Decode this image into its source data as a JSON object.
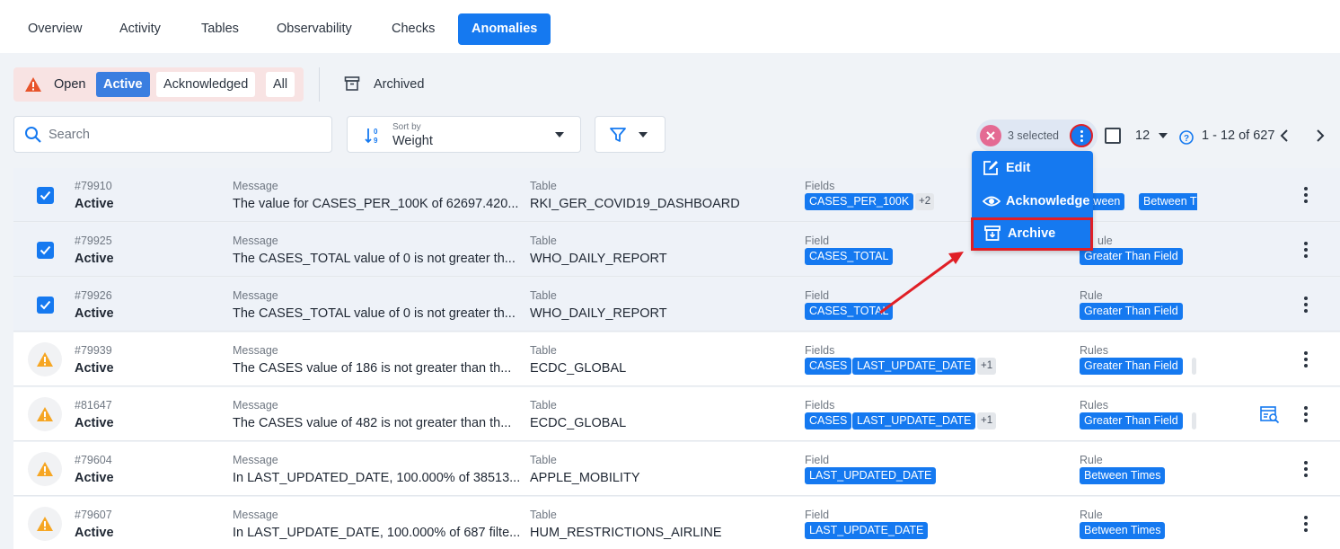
{
  "tabs": [
    "Overview",
    "Activity",
    "Tables",
    "Observability",
    "Checks",
    "Anomalies"
  ],
  "active_tab": "Anomalies",
  "status_filter": {
    "open_label": "Open",
    "options": [
      "Active",
      "Acknowledged",
      "All"
    ],
    "active": "Active",
    "archived_label": "Archived"
  },
  "search": {
    "placeholder": "Search"
  },
  "sort": {
    "label": "Sort by",
    "value": "Weight"
  },
  "selection": {
    "count_label": "3 selected",
    "per_page": "12",
    "range": "1 - 12 of 627"
  },
  "menu": {
    "items": [
      "Edit",
      "Acknowledge",
      "Archive"
    ],
    "highlighted": "Archive"
  },
  "column_labels": {
    "message": "Message",
    "table": "Table"
  },
  "rows": [
    {
      "id": "#79910",
      "status": "Active",
      "selected": true,
      "message": "The value for CASES_PER_100K of 62697.420...",
      "table": "RKI_GER_COVID19_DASHBOARD",
      "fields_label": "Fields",
      "fields": [
        "CASES_PER_100K"
      ],
      "fields_more": "+2",
      "rules_label": "Rules",
      "rules": [
        "etween",
        "Between T"
      ]
    },
    {
      "id": "#79925",
      "status": "Active",
      "selected": true,
      "message": "The CASES_TOTAL value of 0 is not greater th...",
      "table": "WHO_DAILY_REPORT",
      "fields_label": "Field",
      "fields": [
        "CASES_TOTAL"
      ],
      "rules_label": "ule",
      "rules": [
        "Greater Than Field"
      ]
    },
    {
      "id": "#79926",
      "status": "Active",
      "selected": true,
      "message": "The CASES_TOTAL value of 0 is not greater th...",
      "table": "WHO_DAILY_REPORT",
      "fields_label": "Field",
      "fields": [
        "CASES_TOTAL"
      ],
      "rules_label": "Rule",
      "rules": [
        "Greater Than Field"
      ]
    },
    {
      "id": "#79939",
      "status": "Active",
      "selected": false,
      "message": "The CASES value of 186 is not greater than th...",
      "table": "ECDC_GLOBAL",
      "fields_label": "Fields",
      "fields": [
        "CASES",
        "LAST_UPDATE_DATE"
      ],
      "fields_more": "+1",
      "rules_label": "Rules",
      "rules": [
        "Greater Than Field"
      ]
    },
    {
      "id": "#81647",
      "status": "Active",
      "selected": false,
      "message": "The CASES value of 482 is not greater than th...",
      "table": "ECDC_GLOBAL",
      "fields_label": "Fields",
      "fields": [
        "CASES",
        "LAST_UPDATE_DATE"
      ],
      "fields_more": "+1",
      "rules_label": "Rules",
      "rules": [
        "Greater Than Field"
      ],
      "has_dq_icon": true
    },
    {
      "id": "#79604",
      "status": "Active",
      "selected": false,
      "message": "In LAST_UPDATED_DATE, 100.000% of 38513...",
      "table": "APPLE_MOBILITY",
      "fields_label": "Field",
      "fields": [
        "LAST_UPDATED_DATE"
      ],
      "rules_label": "Rule",
      "rules": [
        "Between Times"
      ]
    },
    {
      "id": "#79607",
      "status": "Active",
      "selected": false,
      "message": "In LAST_UPDATE_DATE, 100.000% of 687 filte...",
      "table": "HUM_RESTRICTIONS_AIRLINE",
      "fields_label": "Field",
      "fields": [
        "LAST_UPDATE_DATE"
      ],
      "rules_label": "Rule",
      "rules": [
        "Between Times"
      ]
    }
  ],
  "colors": {
    "accent": "#1579f0",
    "annotation": "#e01f26",
    "warning": "#f6a623"
  }
}
